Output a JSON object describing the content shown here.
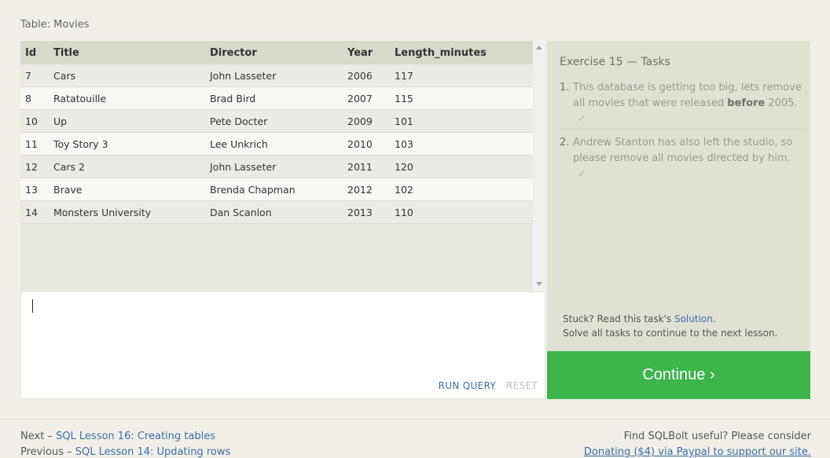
{
  "table": {
    "caption": "Table: Movies",
    "columns": [
      "Id",
      "Title",
      "Director",
      "Year",
      "Length_minutes"
    ],
    "rows": [
      [
        "7",
        "Cars",
        "John Lasseter",
        "2006",
        "117"
      ],
      [
        "8",
        "Ratatouille",
        "Brad Bird",
        "2007",
        "115"
      ],
      [
        "10",
        "Up",
        "Pete Docter",
        "2009",
        "101"
      ],
      [
        "11",
        "Toy Story 3",
        "Lee Unkrich",
        "2010",
        "103"
      ],
      [
        "12",
        "Cars 2",
        "John Lasseter",
        "2011",
        "120"
      ],
      [
        "13",
        "Brave",
        "Brenda Chapman",
        "2012",
        "102"
      ],
      [
        "14",
        "Monsters University",
        "Dan Scanlon",
        "2013",
        "110"
      ]
    ]
  },
  "editor": {
    "run_label": "RUN QUERY",
    "reset_label": "RESET"
  },
  "tasks": {
    "title": "Exercise 15 — Tasks",
    "items": [
      {
        "num": "1.",
        "text_before": "This database is getting too big, lets remove all movies that were released ",
        "bold": "before",
        "text_after": " 2005.",
        "check": "✓"
      },
      {
        "num": "2.",
        "text": "Andrew Stanton has also left the studio, so please remove all movies directed by him.",
        "check": "✓"
      }
    ],
    "stuck_prefix": "Stuck? Read this task's ",
    "solution_label": "Solution",
    "stuck_suffix": ".",
    "solve_all": "Solve all tasks to continue to the next lesson."
  },
  "continue_label": "Continue ›",
  "footer": {
    "next_prefix": "Next – ",
    "next_link": "SQL Lesson 16: Creating tables",
    "prev_prefix": "Previous – ",
    "prev_link": "SQL Lesson 14: Updating rows",
    "right_text": "Find SQLBolt useful? Please consider",
    "right_more": "Donating ($4) via Paypal to support our site."
  },
  "colors": {
    "continue_bg": "#3cb54a",
    "link": "#3a6ea8",
    "check": "#8fcf8f"
  }
}
